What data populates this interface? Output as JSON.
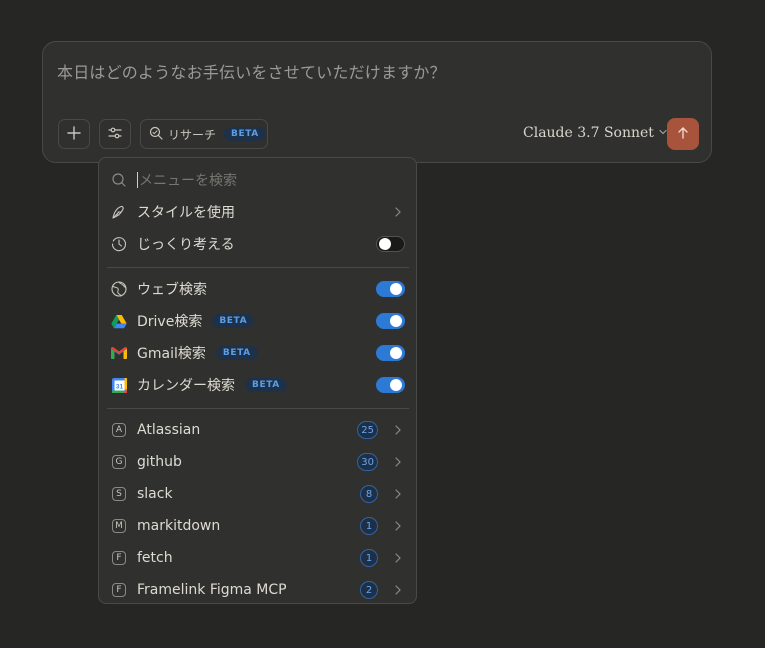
{
  "composer": {
    "placeholder": "本日はどのようなお手伝いをさせていただけますか？",
    "add_icon": "plus-icon",
    "tools_icon": "sliders-icon",
    "research": {
      "label": "リサーチ",
      "badge": "BETA",
      "icon": "research-search-icon"
    },
    "model": "Claude 3.7 Sonnet",
    "send_icon": "arrow-up-icon",
    "send_color": "#a8533b"
  },
  "menu": {
    "search_placeholder": "メニューを検索",
    "items_top": [
      {
        "label": "スタイルを使用",
        "icon": "feather-pen-icon",
        "control": "chevron"
      },
      {
        "label": "じっくり考える",
        "icon": "clock-icon",
        "control": "toggle",
        "enabled": false
      }
    ],
    "items_search": [
      {
        "label": "ウェブ検索",
        "icon": "globe-icon",
        "enabled": true
      },
      {
        "label": "Drive検索",
        "icon": "google-drive-icon",
        "badge": "BETA",
        "enabled": true
      },
      {
        "label": "Gmail検索",
        "icon": "gmail-icon",
        "badge": "BETA",
        "enabled": true
      },
      {
        "label": "カレンダー検索",
        "icon": "google-calendar-icon",
        "badge": "BETA",
        "enabled": true
      }
    ],
    "integrations": [
      {
        "letter": "A",
        "label": "Atlassian",
        "count": "25"
      },
      {
        "letter": "G",
        "label": "github",
        "count": "30"
      },
      {
        "letter": "S",
        "label": "slack",
        "count": "8"
      },
      {
        "letter": "M",
        "label": "markitdown",
        "count": "1"
      },
      {
        "letter": "F",
        "label": "fetch",
        "count": "1"
      },
      {
        "letter": "F",
        "label": "Framelink Figma MCP",
        "count": "2"
      }
    ],
    "toggle_on_color": "#2c7ad6",
    "count_badge_color": "#6ba6ea"
  }
}
